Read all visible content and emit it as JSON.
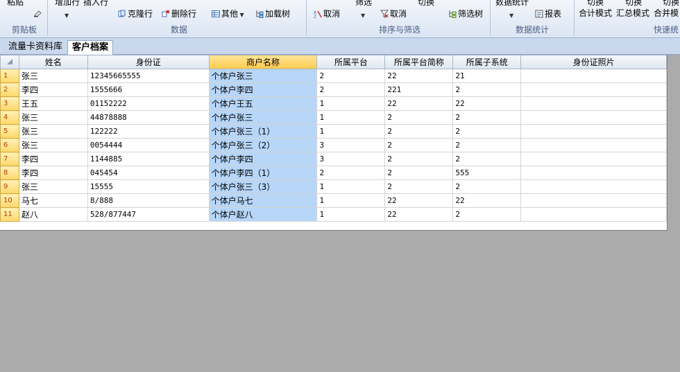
{
  "ribbon": {
    "clipboard": {
      "paste": "粘贴",
      "group": "剪贴板"
    },
    "data": {
      "add_row": "增加行",
      "insert_row": "插入行",
      "clone_row": "克隆行",
      "delete_row": "删除行",
      "other": "其他",
      "load_tree": "加载树",
      "group": "数据"
    },
    "sort_filter": {
      "cancel_sort": "取消",
      "filter": "筛选",
      "cancel_filter": "取消",
      "switch": "切换",
      "filter_tree": "筛选树",
      "group": "排序与筛选"
    },
    "stats": {
      "data_stats": "数据统计",
      "report": "报表",
      "group": "数据统计"
    },
    "quick": {
      "switch1": "切换",
      "total_mode": "合计模式",
      "switch2": "切换",
      "summary_mode": "汇总模式",
      "switch3": "切换",
      "merge_mode": "合并模",
      "group": "快速统"
    }
  },
  "tabs": [
    {
      "label": "流量卡资料库",
      "active": false
    },
    {
      "label": "客户档案",
      "active": true
    }
  ],
  "table": {
    "columns": [
      "姓名",
      "身份证",
      "商户名称",
      "所属平台",
      "所属平台简称",
      "所属子系统",
      "身份证照片"
    ],
    "selected_column_index": 2,
    "rows": [
      {
        "num": "1",
        "cells": [
          "张三",
          "12345665555",
          "个体户张三",
          "2",
          "22",
          "21",
          ""
        ]
      },
      {
        "num": "2",
        "cells": [
          "李四",
          "1555666",
          "个体户李四",
          "2",
          "221",
          "2",
          ""
        ]
      },
      {
        "num": "3",
        "cells": [
          "王五",
          "01152222",
          "个体户王五",
          "1",
          "22",
          "22",
          ""
        ]
      },
      {
        "num": "4",
        "cells": [
          "张三",
          "44878888",
          "个体户张三",
          "1",
          "2",
          "2",
          ""
        ]
      },
      {
        "num": "5",
        "cells": [
          "张三",
          "122222",
          "个体户张三（1）",
          "1",
          "2",
          "2",
          ""
        ]
      },
      {
        "num": "6",
        "cells": [
          "张三",
          "0054444",
          "个体户张三（2）",
          "3",
          "2",
          "2",
          ""
        ]
      },
      {
        "num": "7",
        "cells": [
          "李四",
          "1144885",
          "个体户李四",
          "3",
          "2",
          "2",
          ""
        ]
      },
      {
        "num": "8",
        "cells": [
          "李四",
          "045454",
          "个体户李四（1）",
          "2",
          "2",
          "555",
          ""
        ]
      },
      {
        "num": "9",
        "cells": [
          "张三",
          "15555",
          "个体户张三（3）",
          "1",
          "2",
          "2",
          ""
        ]
      },
      {
        "num": "10",
        "cells": [
          "马七",
          "8/888",
          "个体户马七",
          "1",
          "22",
          "22",
          ""
        ]
      },
      {
        "num": "11",
        "cells": [
          "赵八",
          "528/877447",
          "个体户赵八",
          "1",
          "22",
          "2",
          ""
        ]
      }
    ]
  }
}
